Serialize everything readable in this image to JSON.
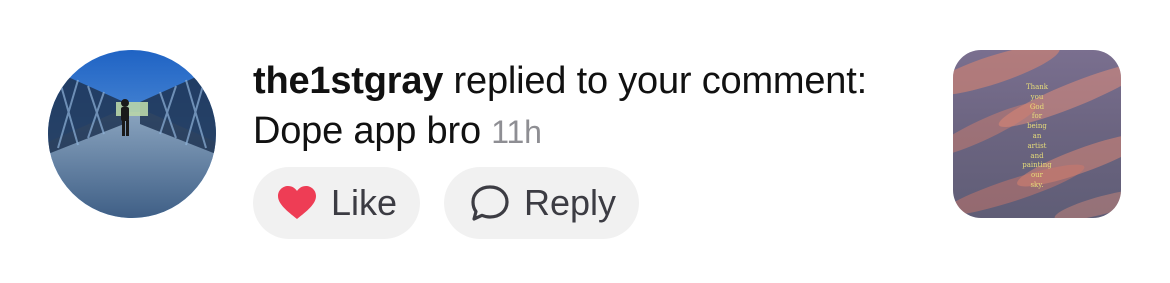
{
  "notification": {
    "username": "the1stgray",
    "action_text": " replied to your comment: ",
    "comment": "Dope app bro",
    "time": "11h",
    "avatar_icon": "profile-photo-bridge",
    "thumbnail_icon": "post-image-sunset-sky"
  },
  "actions": {
    "like_label": "Like",
    "like_icon": "heart-icon",
    "like_color": "#ee3d55",
    "reply_label": "Reply",
    "reply_icon": "speech-bubble-icon"
  },
  "thumbnail": {
    "lines": [
      "Thank",
      "you",
      "God",
      "for",
      "being",
      "an",
      "artist",
      "and",
      "painting",
      "our",
      "sky."
    ]
  },
  "colors": {
    "pill_background": "#f1f1f1",
    "text_primary": "#111111",
    "text_secondary": "#8e8e93"
  }
}
